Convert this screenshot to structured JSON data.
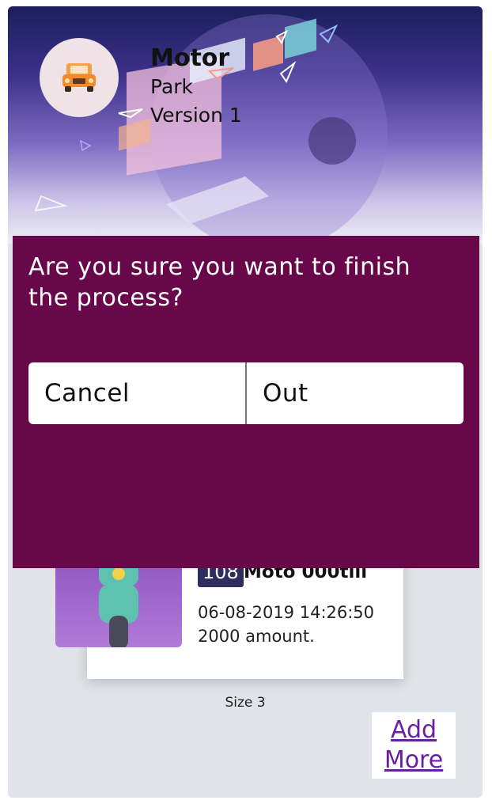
{
  "header": {
    "app_name": "Motor",
    "app_sub": "Park",
    "app_version": "Version 1",
    "logo_icon": "car-icon"
  },
  "dialog": {
    "message": "Are you sure you want to finish the process?",
    "cancel_label": "Cancel",
    "out_label": "Out"
  },
  "card": {
    "image_icon": "scooter-icon",
    "id": "108",
    "name": "Moto 000till",
    "datetime": "06-08-2019 14:26:50",
    "amount": "2000 amount."
  },
  "list": {
    "size_label": "Size 3"
  },
  "actions": {
    "add_more_line1": "Add",
    "add_more_line2": "More"
  },
  "colors": {
    "modal_bg": "#68074a",
    "header_dark": "#1c1f5c",
    "accent_link": "#6a1fa0",
    "id_badge": "#2e2d5e"
  }
}
